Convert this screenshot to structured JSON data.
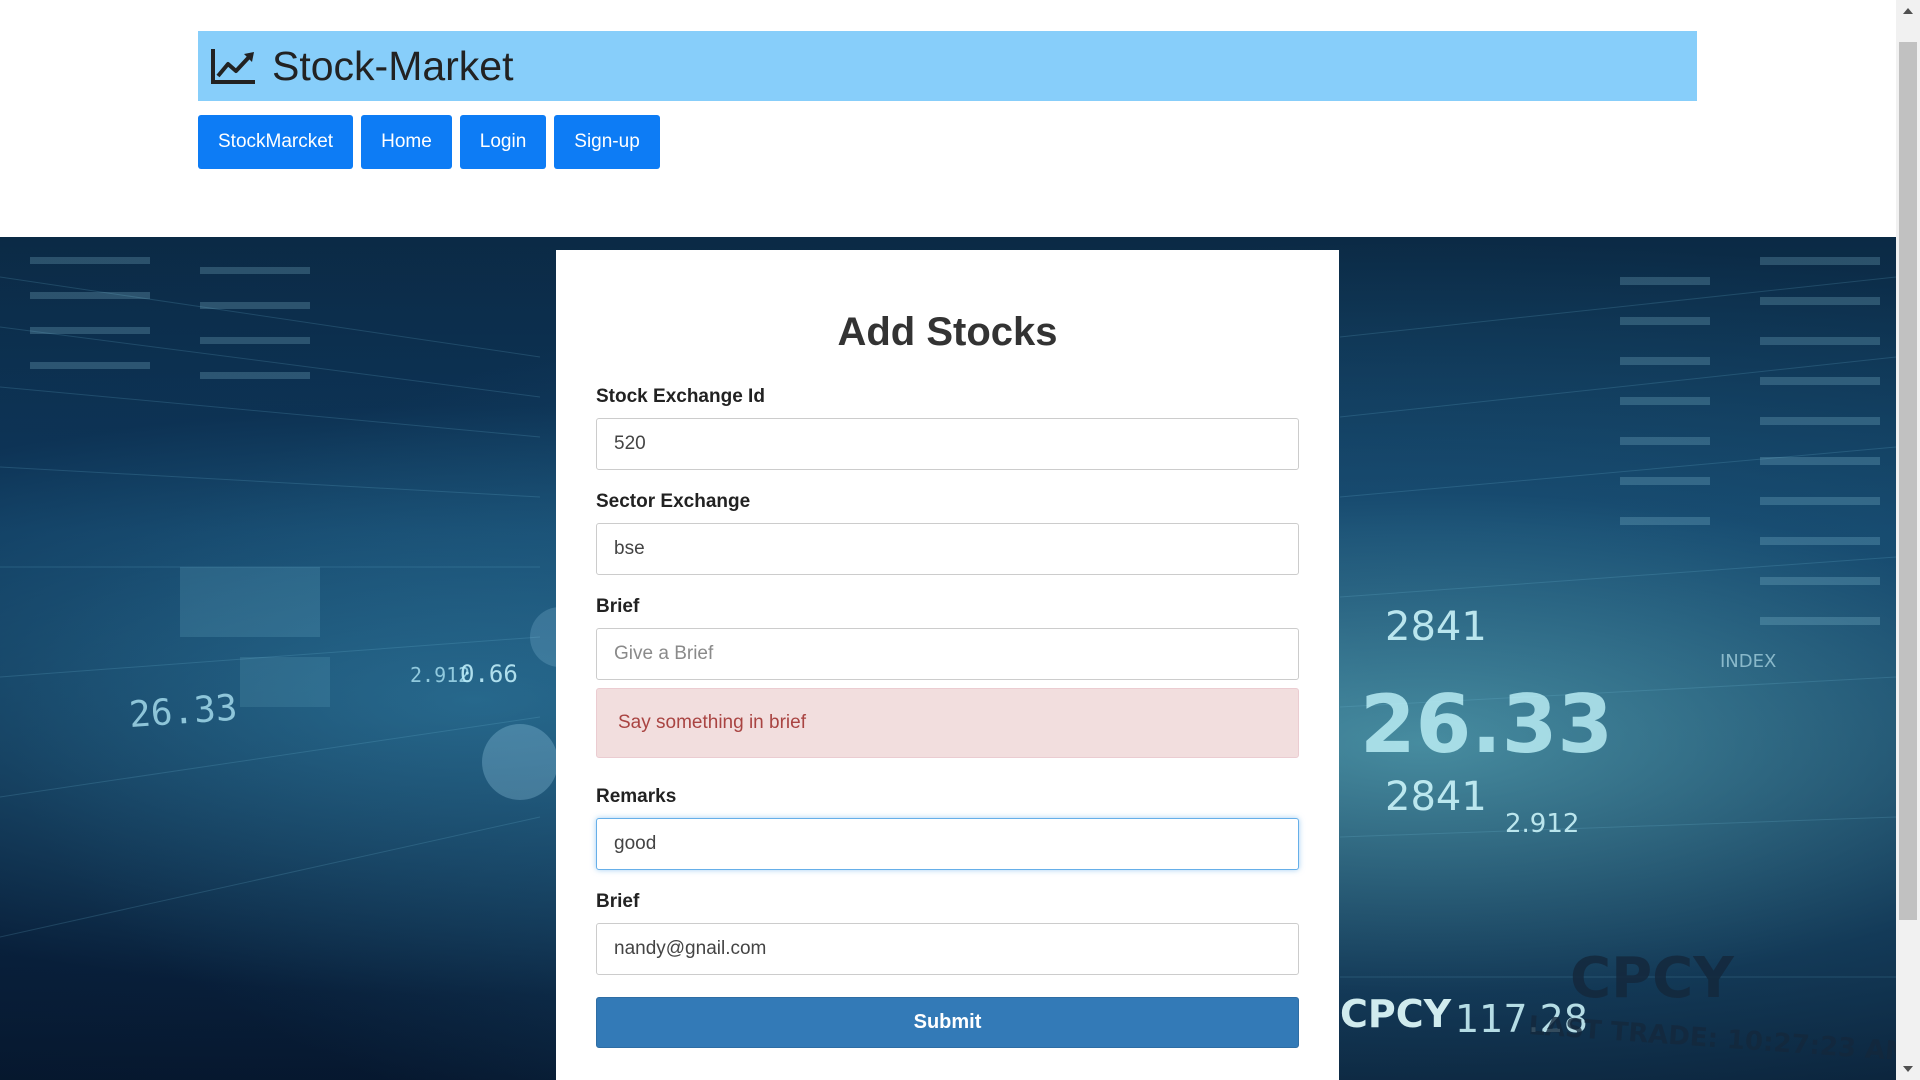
{
  "header": {
    "brand_icon": "line-chart-icon",
    "title": "Stock-Market",
    "brand_bar_color": "#87cefa"
  },
  "nav": {
    "items": [
      {
        "label": "StockMarcket"
      },
      {
        "label": "Home"
      },
      {
        "label": "Login"
      },
      {
        "label": "Sign-up"
      }
    ],
    "button_color": "#0d7cf5"
  },
  "form": {
    "title": "Add Stocks",
    "fields": [
      {
        "label": "Stock Exchange Id",
        "value": "520",
        "placeholder": ""
      },
      {
        "label": "Sector Exchange",
        "value": "bse",
        "placeholder": ""
      },
      {
        "label": "Brief",
        "value": "",
        "placeholder": "Give a Brief",
        "error": "Say something in brief"
      },
      {
        "label": "Remarks",
        "value": "good",
        "placeholder": "",
        "focused": true
      },
      {
        "label": "Brief",
        "value": "nandy@gnail.com",
        "placeholder": ""
      }
    ],
    "submit_label": "Submit",
    "submit_color": "#337ab7",
    "error_color": "#a94442"
  },
  "background": {
    "numbers": [
      "2841",
      "26.33",
      "2841",
      "2.912",
      "117.28",
      "CPCY",
      "LAST TRADE: 10:27:23 AM",
      "CPCY",
      "26.33",
      "0.66",
      "2.912",
      "INDEX"
    ]
  }
}
